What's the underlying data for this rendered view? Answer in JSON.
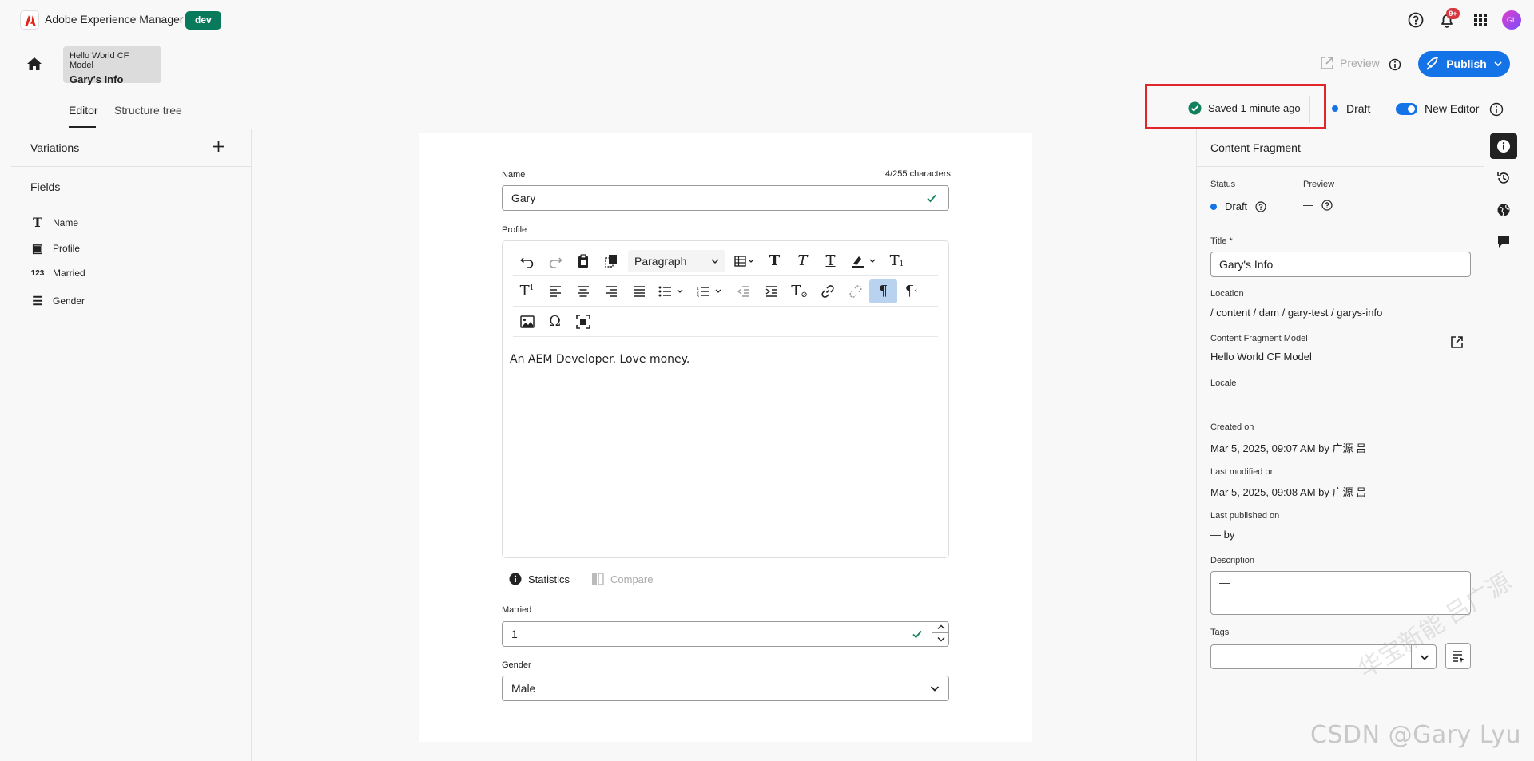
{
  "app": {
    "title": "Adobe Experience Manager",
    "env_badge": "dev",
    "notification_count": "9+",
    "avatar_initials": "GL"
  },
  "header": {
    "fragment_model": "Hello World CF Model",
    "fragment_title": "Gary's Info",
    "preview_label": "Preview",
    "publish_label": "Publish"
  },
  "tabs": [
    {
      "label": "Editor",
      "active": true
    },
    {
      "label": "Structure tree",
      "active": false
    }
  ],
  "status": {
    "saved_text": "Saved 1 minute ago",
    "draft_label": "Draft",
    "new_editor_label": "New Editor",
    "new_editor_on": true
  },
  "sidebar": {
    "variations_label": "Variations",
    "fields_label": "Fields",
    "fields": [
      {
        "icon": "text-icon",
        "glyph": "T",
        "label": "Name"
      },
      {
        "icon": "rich-text-icon",
        "glyph": "▣",
        "label": "Profile"
      },
      {
        "icon": "number-icon",
        "glyph": "123",
        "label": "Married"
      },
      {
        "icon": "enumeration-icon",
        "glyph": "☰",
        "label": "Gender"
      }
    ]
  },
  "editor": {
    "name_label": "Name",
    "name_char_count": "4/255 characters",
    "name_value": "Gary",
    "profile_label": "Profile",
    "paragraph_format": "Paragraph",
    "profile_content": "An AEM Developer. Love money.",
    "statistics_label": "Statistics",
    "compare_label": "Compare",
    "married_label": "Married",
    "married_value": "1",
    "gender_label": "Gender",
    "gender_value": "Male"
  },
  "properties": {
    "panel_title": "Content Fragment",
    "status_label": "Status",
    "status_value": "Draft",
    "preview_label": "Preview",
    "preview_value": "—",
    "title_label": "Title",
    "title_required_mark": "*",
    "title_value": "Gary's Info",
    "location_label": "Location",
    "location_value": "/ content / dam / gary-test / garys-info",
    "model_label": "Content Fragment Model",
    "model_value": "Hello World CF Model",
    "locale_label": "Locale",
    "locale_value": "—",
    "created_label": "Created on",
    "created_value": "Mar 5, 2025, 09:07 AM by 广源 吕",
    "modified_label": "Last modified on",
    "modified_value": "Mar 5, 2025, 09:08 AM by 广源 吕",
    "published_label": "Last published on",
    "published_value": "— by",
    "description_label": "Description",
    "description_value": "—",
    "tags_label": "Tags"
  },
  "watermark": {
    "text": "CSDN @Gary Lyu",
    "diagonal": "华宝新能 吕广源"
  },
  "colors": {
    "accent": "#1473e6",
    "env_badge": "#087a5b",
    "success": "#12805c",
    "highlight": "#e0252b"
  }
}
